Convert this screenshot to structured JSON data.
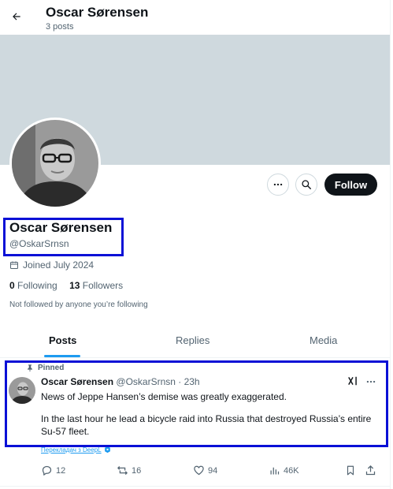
{
  "header": {
    "name": "Oscar Sørensen",
    "posts_count": "3 posts"
  },
  "profile": {
    "display_name": "Oscar Sørensen",
    "handle": "@OskarSrnsn",
    "joined": "Joined July 2024",
    "following_count": "0",
    "following_label": "Following",
    "followers_count": "13",
    "followers_label": "Followers",
    "not_followed": "Not followed by anyone you’re following",
    "follow_button": "Follow"
  },
  "tabs": [
    {
      "label": "Posts",
      "active": true
    },
    {
      "label": "Replies",
      "active": false
    },
    {
      "label": "Media",
      "active": false
    }
  ],
  "post": {
    "pinned_label": "Pinned",
    "author_name": "Oscar Sørensen",
    "author_meta": "@OskarSrnsn · 23h",
    "paragraphs": [
      "News of Jeppe Hansen’s demise was greatly exaggerated.",
      "In the last hour he lead a bicycle raid into Russia that destroyed Russia’s entire Su-57 fleet."
    ],
    "translate_label": "Перекладач з DeepL",
    "replies": "12",
    "reposts": "16",
    "likes": "94",
    "views": "46K"
  },
  "colors": {
    "accent": "#1d9bf0",
    "highlight": "#0a10d6",
    "banner": "#cfd9de"
  }
}
